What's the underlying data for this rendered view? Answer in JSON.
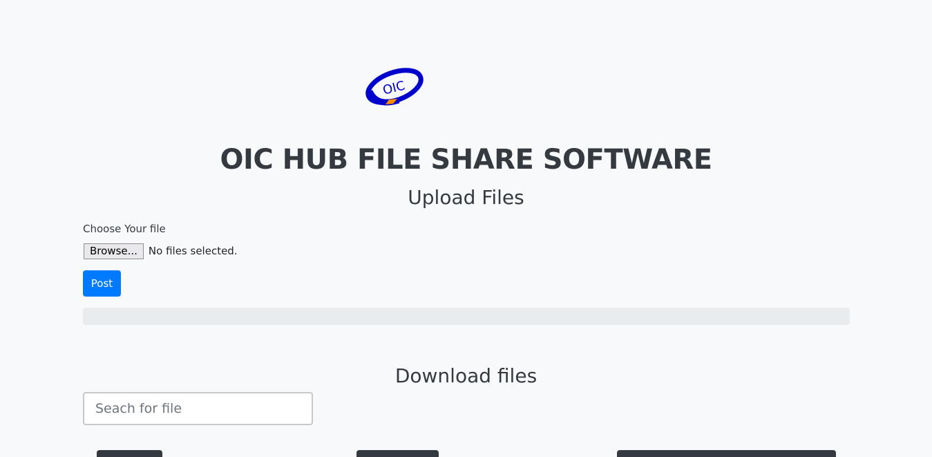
{
  "logo": {
    "text": "OIC",
    "colors": {
      "ring": "#0000cc",
      "text": "#0000cc",
      "accent": "#ff8c00"
    }
  },
  "header": {
    "title": "OIC HUB FILE SHARE SOFTWARE"
  },
  "upload": {
    "title": "Upload Files",
    "file_label": "Choose Your file",
    "browse_label": "Browse...",
    "file_status": "No files selected.",
    "post_label": "Post",
    "progress_percent": 0
  },
  "download": {
    "title": "Download files",
    "search": {
      "placeholder": "Seach for file",
      "value": ""
    },
    "file_cards": [
      {},
      {},
      {}
    ]
  },
  "colors": {
    "accent": "#007bff",
    "background": "#f8f9fa",
    "text": "#343a40",
    "card_header": "#343a40",
    "progress_track": "#e9ecef"
  }
}
